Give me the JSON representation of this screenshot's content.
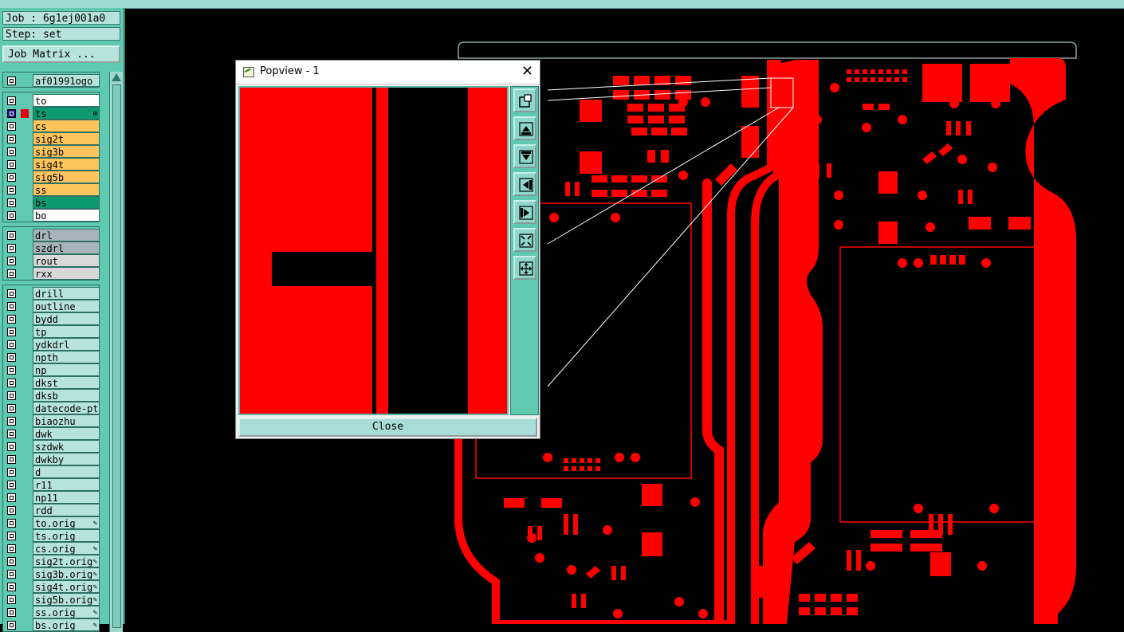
{
  "header": {
    "job_label": "Job : 6g1ej001a0",
    "step_label": "Step: set",
    "job_matrix_button": "Job Matrix ..."
  },
  "layer_groups": [
    [
      {
        "name": "af01991ogo",
        "color": "#b7e3de",
        "on": false,
        "selected": false
      }
    ],
    [
      {
        "name": "to",
        "color": "#ffffff",
        "on": false,
        "selected": false
      },
      {
        "name": "ts",
        "color": "#0d9a70",
        "on": true,
        "selected": true,
        "suffix": "⊞"
      },
      {
        "name": "cs",
        "color": "#ffc45c",
        "on": false,
        "selected": false
      },
      {
        "name": "sig2t",
        "color": "#ffc45c",
        "on": false,
        "selected": false
      },
      {
        "name": "sig3b",
        "color": "#ffc45c",
        "on": false,
        "selected": false
      },
      {
        "name": "sig4t",
        "color": "#ffc45c",
        "on": false,
        "selected": false
      },
      {
        "name": "sig5b",
        "color": "#ffc45c",
        "on": false,
        "selected": false
      },
      {
        "name": "ss",
        "color": "#ffc45c",
        "on": false,
        "selected": false
      },
      {
        "name": "bs",
        "color": "#0d9a70",
        "on": false,
        "selected": false
      },
      {
        "name": "bo",
        "color": "#ffffff",
        "on": false,
        "selected": false
      }
    ],
    [
      {
        "name": "drl",
        "color": "#a8b4bc",
        "on": false,
        "selected": false
      },
      {
        "name": "szdrl",
        "color": "#a8b4bc",
        "on": false,
        "selected": false
      },
      {
        "name": "rout",
        "color": "#d8d8d8",
        "on": false,
        "selected": false
      },
      {
        "name": "rxx",
        "color": "#d8d8d8",
        "on": false,
        "selected": false
      }
    ],
    [
      {
        "name": "drill",
        "color": "#b7e3de"
      },
      {
        "name": "outline",
        "color": "#b7e3de"
      },
      {
        "name": "bydd",
        "color": "#b7e3de"
      },
      {
        "name": "tp",
        "color": "#b7e3de"
      },
      {
        "name": "ydkdrl",
        "color": "#b7e3de"
      },
      {
        "name": "npth",
        "color": "#b7e3de"
      },
      {
        "name": "np",
        "color": "#b7e3de"
      },
      {
        "name": "dkst",
        "color": "#b7e3de"
      },
      {
        "name": "dksb",
        "color": "#b7e3de"
      },
      {
        "name": "datecode-pth",
        "color": "#b7e3de"
      },
      {
        "name": "biaozhu",
        "color": "#b7e3de"
      },
      {
        "name": "dwk",
        "color": "#b7e3de"
      },
      {
        "name": "szdwk",
        "color": "#b7e3de"
      },
      {
        "name": "dwkby",
        "color": "#b7e3de"
      },
      {
        "name": "d",
        "color": "#b7e3de"
      },
      {
        "name": "r11",
        "color": "#b7e3de"
      },
      {
        "name": "np11",
        "color": "#b7e3de"
      },
      {
        "name": "rdd",
        "color": "#b7e3de"
      },
      {
        "name": "to.orig",
        "color": "#b7e3de",
        "suffix": "✎"
      },
      {
        "name": "ts.orig",
        "color": "#b7e3de"
      },
      {
        "name": "cs.orig",
        "color": "#b7e3de",
        "suffix": "✎"
      },
      {
        "name": "sig2t.orig",
        "color": "#b7e3de",
        "suffix": "✎"
      },
      {
        "name": "sig3b.orig",
        "color": "#b7e3de",
        "suffix": "✎"
      },
      {
        "name": "sig4t.orig",
        "color": "#b7e3de",
        "suffix": "✎"
      },
      {
        "name": "sig5b.orig",
        "color": "#b7e3de",
        "suffix": "✎"
      },
      {
        "name": "ss.orig",
        "color": "#b7e3de",
        "suffix": "✎"
      },
      {
        "name": "bs.orig",
        "color": "#b7e3de",
        "suffix": "✎"
      }
    ]
  ],
  "popview": {
    "title": "Popview - 1",
    "close_button": "Close",
    "tool_icons": [
      "zoom-home-icon",
      "pan-up-icon",
      "pan-down-icon",
      "pan-left-icon",
      "pan-right-icon",
      "zoom-out-icon",
      "zoom-in-icon"
    ]
  },
  "colors": {
    "copper": "#ff0000",
    "panel": "#5fc9b2",
    "background": "#000000"
  }
}
